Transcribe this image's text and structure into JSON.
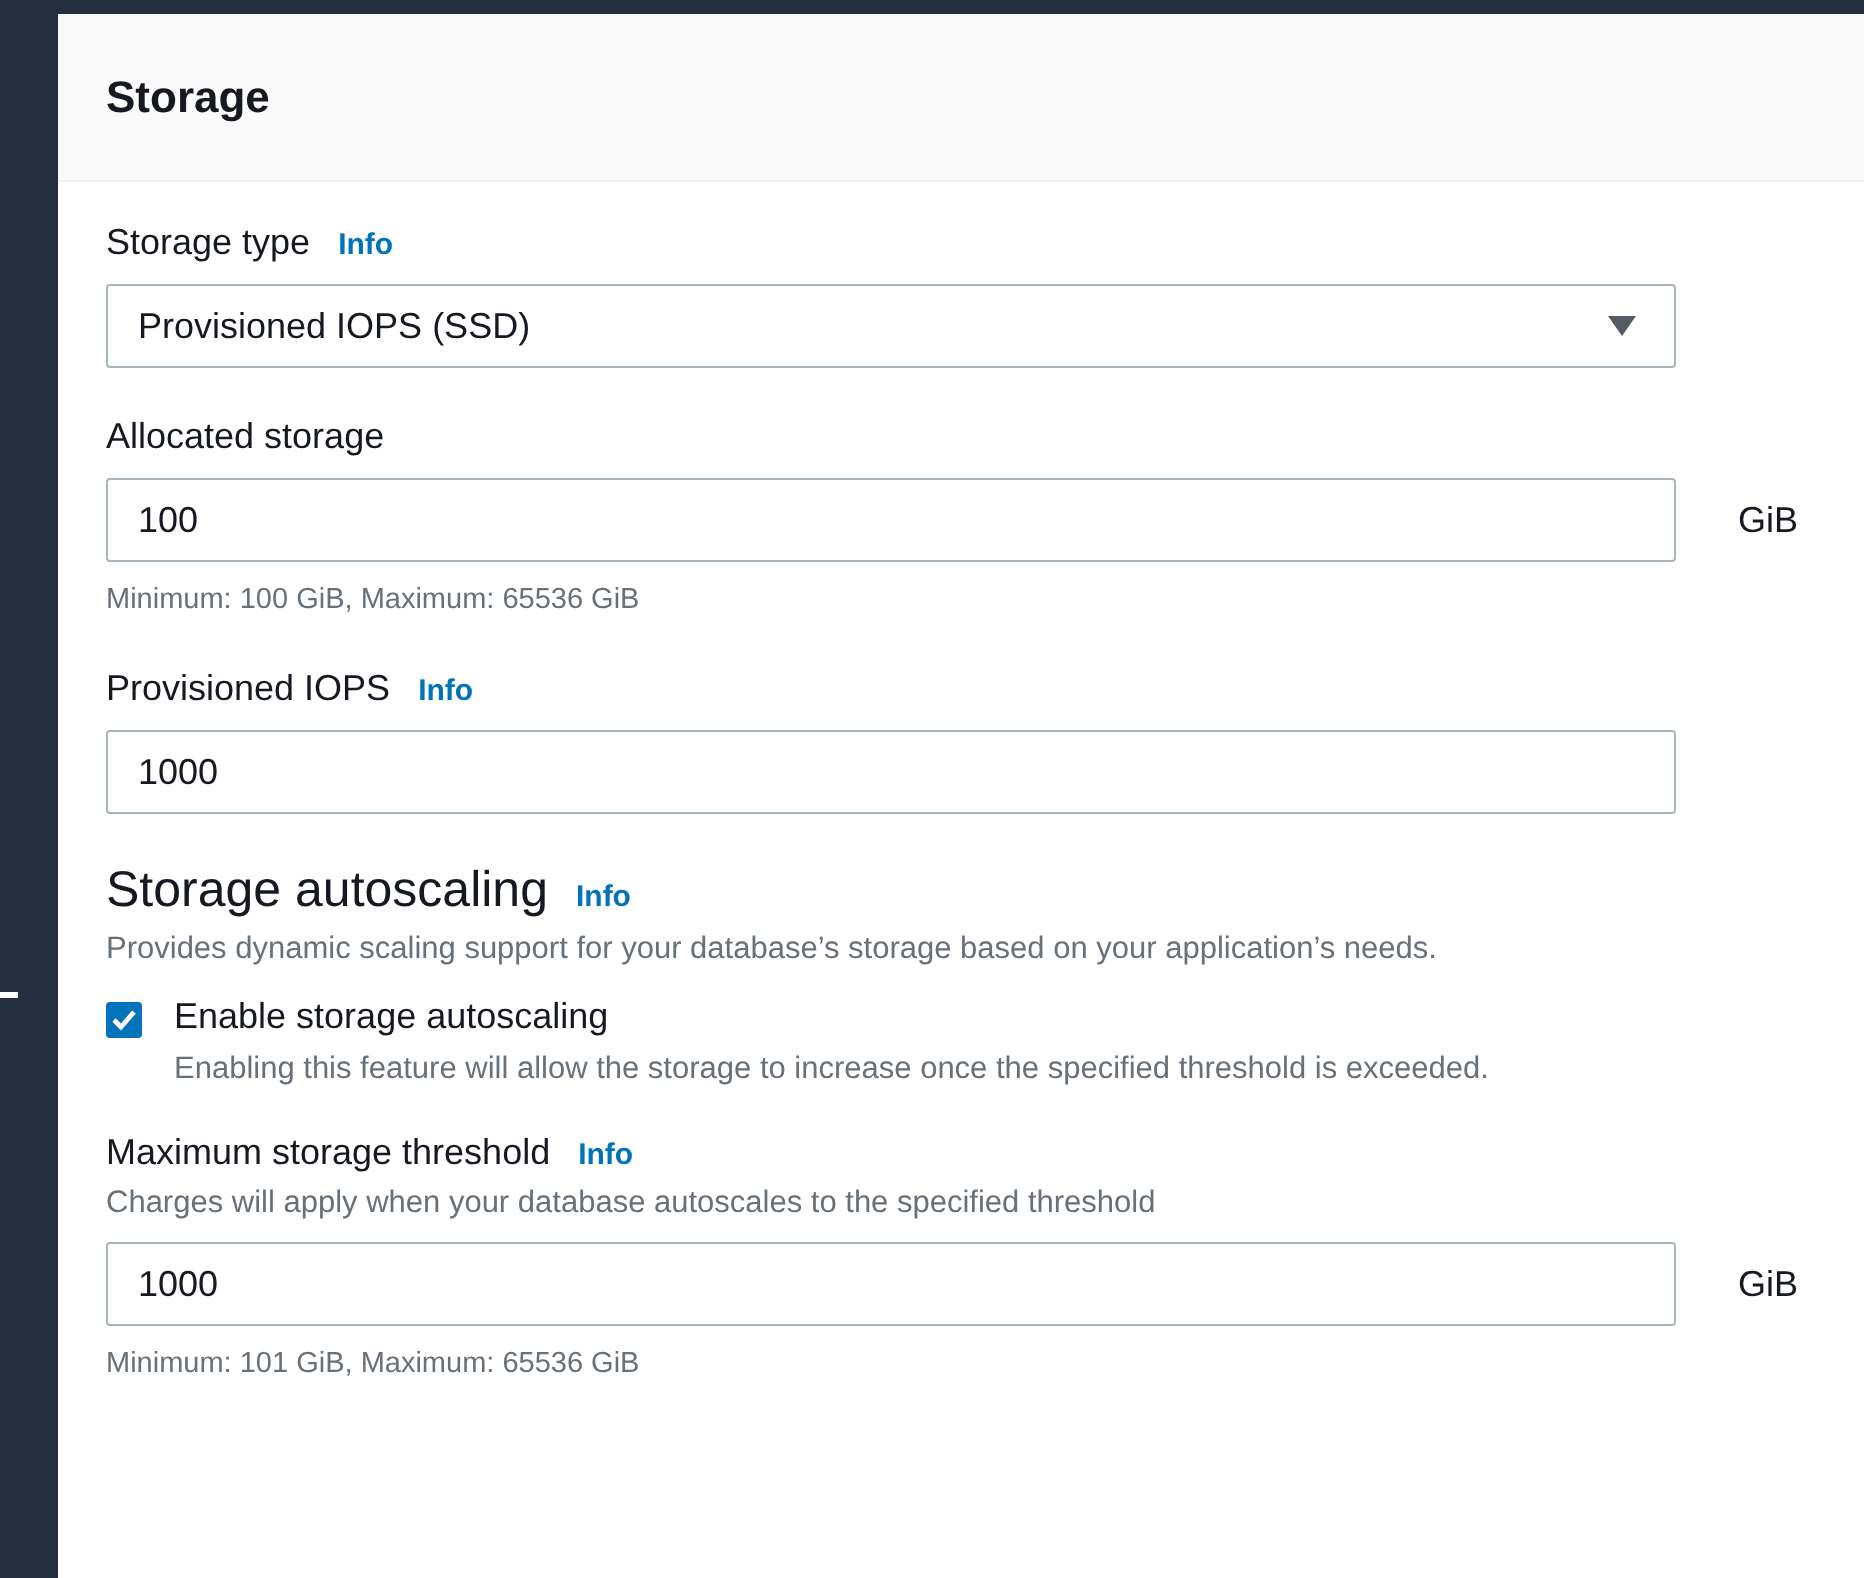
{
  "panel": {
    "title": "Storage"
  },
  "fields": [
    {
      "kind": "select",
      "label": "Storage type",
      "info": "Info",
      "value": "Provisioned IOPS (SSD)"
    },
    {
      "kind": "input",
      "label": "Allocated storage",
      "value": "100",
      "unit": "GiB",
      "hint": "Minimum: 100 GiB, Maximum: 65536 GiB"
    },
    {
      "kind": "input",
      "label": "Provisioned IOPS",
      "info": "Info",
      "value": "1000"
    }
  ],
  "autoscaling": {
    "title": "Storage autoscaling",
    "info": "Info",
    "description": "Provides dynamic scaling support for your database’s storage based on your application’s needs.",
    "checkbox": {
      "label": "Enable storage autoscaling",
      "checked": true,
      "description": "Enabling this feature will allow the storage to increase once the specified threshold is exceeded."
    },
    "fields": [
      {
        "kind": "input",
        "label": "Maximum storage threshold",
        "info": "Info",
        "description": "Charges will apply when your database autoscales to the specified threshold",
        "value": "1000",
        "unit": "GiB",
        "hint": "Minimum: 101 GiB, Maximum: 65536 GiB"
      }
    ]
  }
}
